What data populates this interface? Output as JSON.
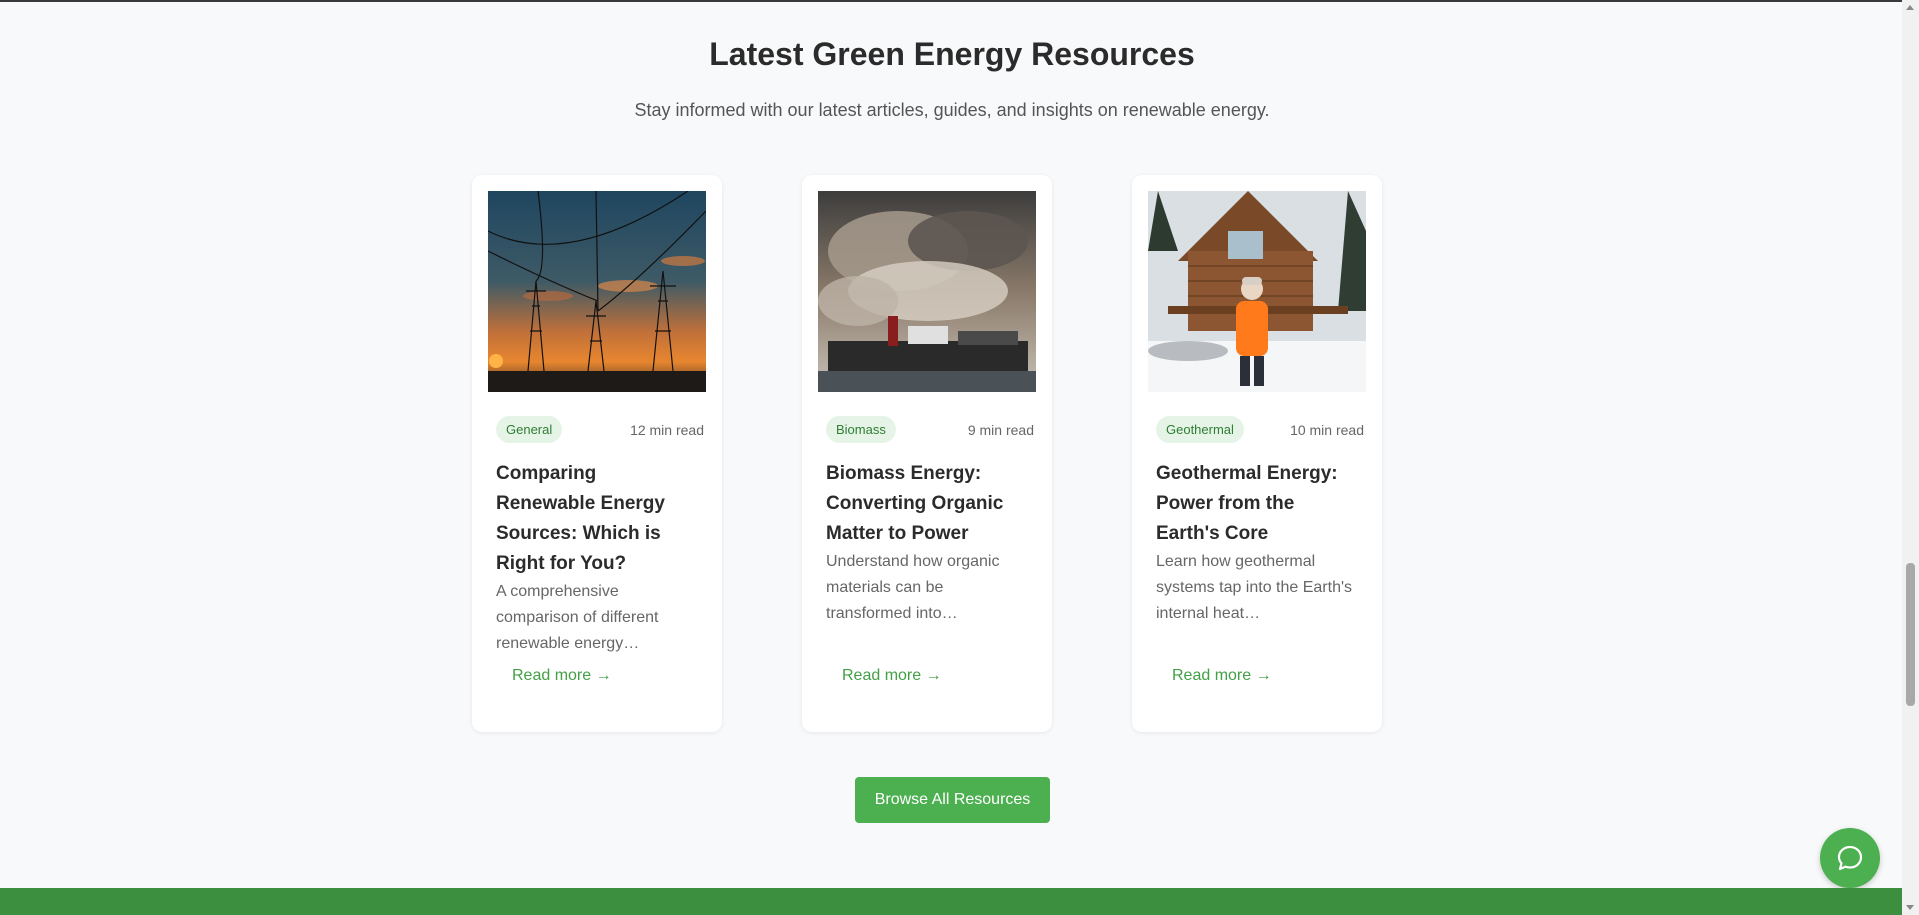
{
  "section": {
    "title": "Latest Green Energy Resources",
    "subtitle": "Stay informed with our latest articles, guides, and insights on renewable energy."
  },
  "articles": [
    {
      "tag": "General",
      "read_time": "12 min read",
      "title": "Comparing Renewable Energy Sources: Which is Right for You?",
      "excerpt": "A comprehensive comparison of different renewable energy…",
      "read_more": "Read more →",
      "image": "power-lines-sunset"
    },
    {
      "tag": "Biomass",
      "read_time": "9 min read",
      "title": "Biomass Energy: Converting Organic Matter to Power",
      "excerpt": "Understand how organic materials can be transformed into…",
      "read_more": "Read more →",
      "image": "industrial-smoke-ship"
    },
    {
      "tag": "Geothermal",
      "read_time": "10 min read",
      "title": "Geothermal Energy: Power from the Earth's Core",
      "excerpt": "Learn how geothermal systems tap into the Earth's internal heat…",
      "read_more": "Read more →",
      "image": "snowy-cabin-person"
    }
  ],
  "browse_button": "Browse All Resources",
  "chat_icon": "chat-bubble-icon",
  "colors": {
    "accent": "#4caf50",
    "link": "#43a047",
    "tag_bg": "#e6f4e8",
    "tag_text": "#2e7d32",
    "footer": "#3b8f3f",
    "page_bg": "#f8f9fa"
  }
}
